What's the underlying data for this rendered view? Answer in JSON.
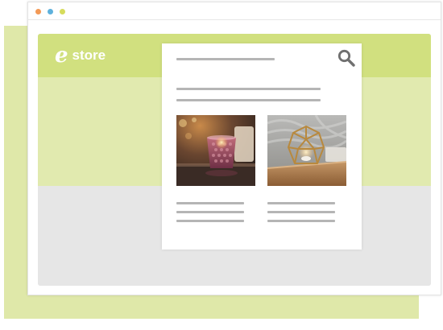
{
  "window": {
    "controls": [
      "close",
      "minimize",
      "maximize"
    ]
  },
  "site": {
    "logo_mark": "e",
    "logo_text": "store"
  },
  "panel": {
    "search_icon": "search-icon",
    "products": [
      {
        "image": "candle-holder-photo"
      },
      {
        "image": "geometric-lantern-photo"
      }
    ]
  },
  "colors": {
    "accent_green": "#d1e07f",
    "hero_green": "#e1eaaf",
    "backdrop_green": "#dfe8a9",
    "body_gray": "#e6e6e6",
    "placeholder_gray": "#b5b5b5"
  }
}
